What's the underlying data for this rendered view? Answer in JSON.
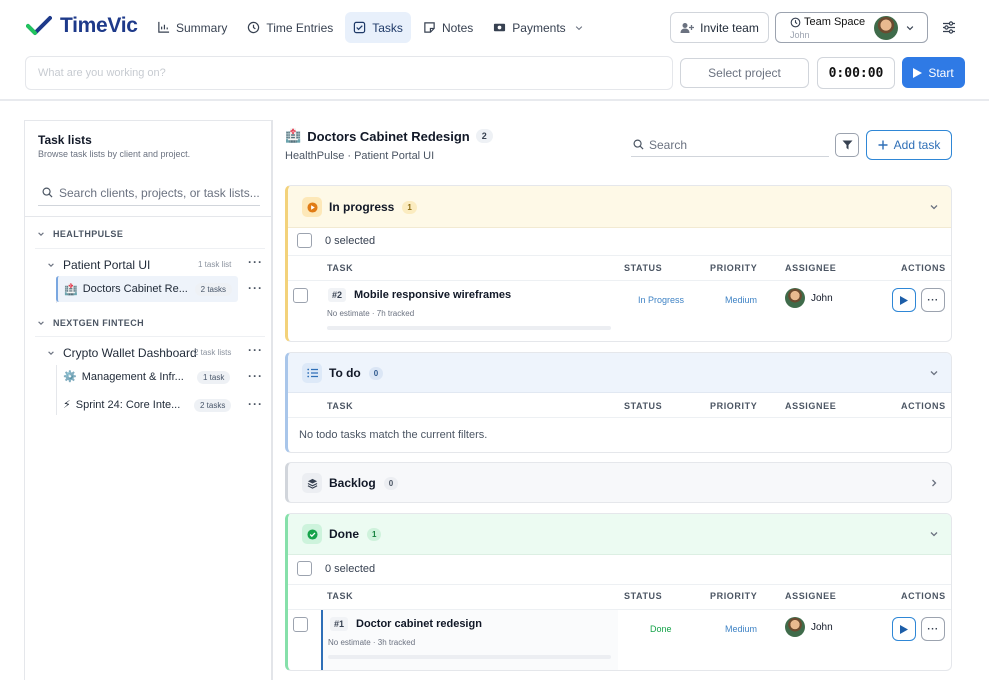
{
  "app": {
    "name": "TimeVic"
  },
  "nav": {
    "summary": "Summary",
    "time_entries": "Time Entries",
    "tasks": "Tasks",
    "notes": "Notes",
    "payments": "Payments"
  },
  "header": {
    "invite_label": "Invite team",
    "team_title": "Team Space",
    "team_user": "John"
  },
  "timer": {
    "placeholder": "What are you working on?",
    "select_project": "Select project",
    "time": "0:00:00",
    "start_label": "Start"
  },
  "sidebar": {
    "title": "Task lists",
    "subtitle": "Browse task lists by client and project.",
    "search_placeholder": "Search clients, projects, or task lists...",
    "clients": [
      {
        "name": "HEALTHPULSE",
        "projects": [
          {
            "name": "Patient Portal UI",
            "meta": "1 task list",
            "lists": [
              {
                "emoji": "🏥",
                "name": "Doctors Cabinet Re...",
                "count": "2 tasks"
              }
            ]
          }
        ]
      },
      {
        "name": "NEXTGEN FINTECH",
        "projects": [
          {
            "name": "Crypto Wallet Dashboard",
            "meta": "2 task lists",
            "lists": [
              {
                "emoji": "⚙️",
                "name": "Management & Infr...",
                "count": "1 task"
              },
              {
                "emoji": "⚡",
                "name": "Sprint 24: Core Inte...",
                "count": "2 tasks"
              }
            ]
          }
        ]
      }
    ]
  },
  "main": {
    "emoji": "🏥",
    "title": "Doctors Cabinet Redesign",
    "count": "2",
    "subtitle": "HealthPulse · Patient Portal UI",
    "search_placeholder": "Search",
    "add_task_label": "Add task",
    "columns": {
      "task": "TASK",
      "status": "STATUS",
      "priority": "PRIORITY",
      "assignee": "ASSIGNEE",
      "actions": "ACTIONS"
    },
    "sections": {
      "in_progress": {
        "label": "In progress",
        "count": "1",
        "selected": "0 selected",
        "task": {
          "num": "#2",
          "name": "Mobile responsive wireframes",
          "meta": "No estimate · 7h tracked",
          "status": "In Progress",
          "priority": "Medium",
          "assignee": "John"
        }
      },
      "todo": {
        "label": "To do",
        "count": "0",
        "empty": "No todo tasks match the current filters."
      },
      "backlog": {
        "label": "Backlog",
        "count": "0"
      },
      "done": {
        "label": "Done",
        "count": "1",
        "selected": "0 selected",
        "task": {
          "num": "#1",
          "name": "Doctor cabinet redesign",
          "meta": "No estimate · 3h tracked",
          "status": "Done",
          "priority": "Medium",
          "assignee": "John"
        }
      }
    }
  },
  "colors": {
    "brand": "#1e3a8a",
    "accent": "#2f7ae5",
    "in_progress_bg": "#fef9e7",
    "todo_bg": "#eef4fc",
    "done_bg": "#ecfbf2"
  },
  "icons": [
    "check-logo-icon",
    "bar-chart-icon",
    "clock-icon",
    "checkbox-icon",
    "note-icon",
    "payments-icon",
    "chevron-down-icon",
    "user-plus-icon",
    "settings-sliders-icon",
    "play-icon",
    "search-icon",
    "filter-icon",
    "plus-icon",
    "list-icon",
    "layers-icon",
    "check-circle-icon",
    "chevron-right-icon"
  ]
}
